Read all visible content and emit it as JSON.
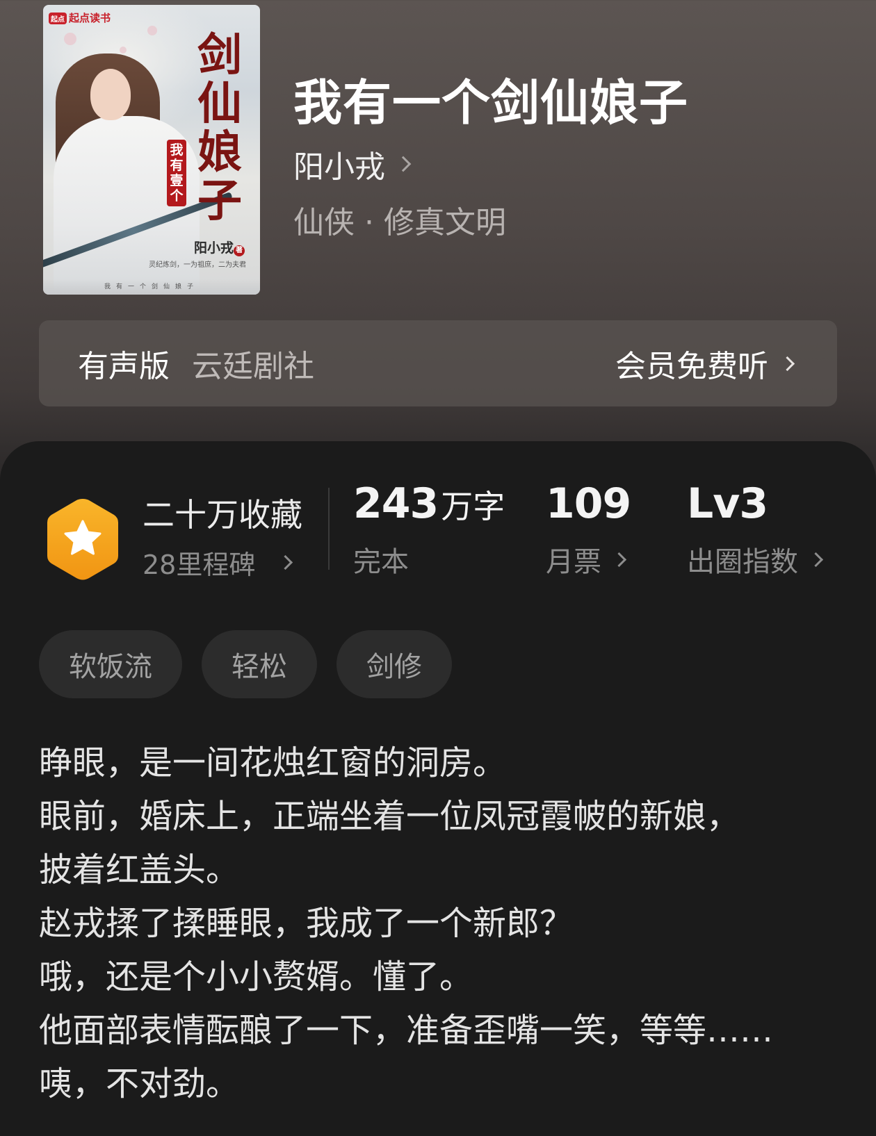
{
  "book": {
    "title": "我有一个剑仙娘子",
    "author": "阳小戎",
    "genre": "仙侠 · 修真文明"
  },
  "cover": {
    "brand": "起点读书",
    "brand_logo": "起点",
    "calligraphy": "剑仙娘子",
    "seal": "我有壹个",
    "author": "阳小戎",
    "author_mark": "著",
    "tagline": "灵纪炼剑，一为祖庶，二为夫君",
    "strip": "我有一个剑仙娘子"
  },
  "audio": {
    "label": "有声版",
    "studio": "云廷剧社",
    "action": "会员免费听"
  },
  "stats": {
    "favorites": "二十万收藏",
    "milestones": "28里程碑",
    "words_number": "243",
    "words_unit": "万字",
    "status": "完本",
    "monthly_votes": "109",
    "monthly_votes_label": "月票",
    "level": "Lv3",
    "level_label": "出圈指数"
  },
  "tags": [
    "软饭流",
    "轻松",
    "剑修"
  ],
  "description": [
    "睁眼，是一间花烛红窗的洞房。",
    "眼前，婚床上，正端坐着一位凤冠霞帔的新娘，",
    "披着红盖头。",
    "赵戎揉了揉睡眼，我成了一个新郎？",
    "哦，还是个小小赘婿。懂了。",
    "他面部表情酝酿了一下，准备歪嘴一笑，等等……",
    "咦，不对劲。"
  ],
  "colors": {
    "badge_orange": "#f7a51c",
    "panel_bg": "#1b1b1b",
    "tag_bg": "#2c2c2c"
  }
}
